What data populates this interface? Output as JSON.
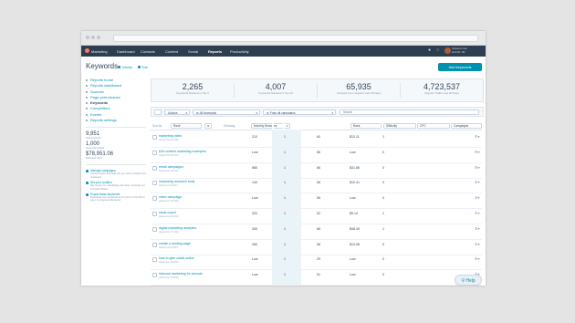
{
  "browser": {},
  "nav": {
    "items": [
      "Marketing",
      "Dashboard",
      "Contacts",
      "Content",
      "Social",
      "Reports",
      "Productivity"
    ],
    "active": "Reports",
    "account_name": "hubspot.com",
    "account_id": "Hub ID: 00"
  },
  "page": {
    "title": "Keywords",
    "links": [
      "Tutorial",
      "Tour"
    ],
    "add_button": "Add keywords"
  },
  "sidebar": {
    "items": [
      "Reports home",
      "Reports dashboard",
      "Sources",
      "Page performance",
      "Keywords",
      "Competitors",
      "Events",
      "Reports settings"
    ],
    "active": "Keywords",
    "stats": [
      {
        "value": "9,951",
        "label": "Total keywords"
      },
      {
        "value": "1,000",
        "label": "Keywords tracked"
      },
      {
        "value": "$78,951.06",
        "label": "Estimated value"
      }
    ],
    "help": [
      {
        "title": "Manage campaigns",
        "desc": "Choose topics that help you get more contacts and customers"
      },
      {
        "title": "Set your location",
        "desc": "Set country for calculating rank data. Currently set to United States."
      },
      {
        "title": "Export these keywords",
        "desc": "Download your keywords as an XLS or CSV file to open in programs like Excel."
      }
    ]
  },
  "summary": [
    {
      "value": "2,265",
      "label": "Keywords Ranked in Top 3"
    },
    {
      "value": "4,007",
      "label": "Keywords Ranked in Top 10"
    },
    {
      "value": "65,935",
      "label": "Contacts from Organic Last 30 Days"
    },
    {
      "value": "4,723,537",
      "label": "Organic Traffic Last 30 Days"
    }
  ],
  "toolbar": {
    "actions": "Actions",
    "filter": "All Keywords",
    "campaign": "From all campaigns",
    "search_placeholder": "Search"
  },
  "table": {
    "sort_label": "Sort by",
    "sort_value": "Rank",
    "show_label": "Showing",
    "show_value": "Monthly Searches",
    "columns": [
      "Rank",
      "Difficulty",
      "CPC",
      "Campaigns"
    ],
    "rows": [
      {
        "keyword": "marketing video",
        "added": "Added Oct 29 2014",
        "searches": "210",
        "rank": "1",
        "difficulty": "60",
        "cpc": "$13.11",
        "campaigns": "1"
      },
      {
        "keyword": "b2b content marketing examples",
        "added": "Added Oct 28 2014",
        "searches": "Low",
        "rank": "1",
        "difficulty": "56",
        "cpc": "Low",
        "campaigns": "0"
      },
      {
        "keyword": "email campaigns",
        "added": "Added Jan 28 2015",
        "searches": "880",
        "rank": "1",
        "difficulty": "66",
        "cpc": "$31.86",
        "campaigns": "0"
      },
      {
        "keyword": "marketing research tools",
        "added": "Added Jul 29 2014",
        "searches": "140",
        "rank": "1",
        "difficulty": "56",
        "cpc": "$10.41",
        "campaigns": "0"
      },
      {
        "keyword": "video campaign",
        "added": "Added Jan 28 2015",
        "searches": "Low",
        "rank": "1",
        "difficulty": "56",
        "cpc": "Low",
        "campaigns": "0"
      },
      {
        "keyword": "seals coach",
        "added": "Added Jan 09 2014",
        "searches": "320",
        "rank": "1",
        "difficulty": "52",
        "cpc": "$5.14",
        "campaigns": "1"
      },
      {
        "keyword": "digital marketing analytics",
        "added": "Added Oct 17 2014",
        "searches": "260",
        "rank": "1",
        "difficulty": "66",
        "cpc": "$48.49",
        "campaigns": "1"
      },
      {
        "keyword": "create a landing page",
        "added": "Added Jul 29 2014",
        "searches": "260",
        "rank": "1",
        "difficulty": "58",
        "cpc": "$13.08",
        "campaigns": "0"
      },
      {
        "keyword": "how to give credit online",
        "added": "Added Jan 28 2015",
        "searches": "Low",
        "rank": "1",
        "difficulty": "29",
        "cpc": "Low",
        "campaigns": "0"
      },
      {
        "keyword": "inbound marketing for schools",
        "added": "Added Jan 28 2015",
        "searches": "Low",
        "rank": "1",
        "difficulty": "51",
        "cpc": "Low",
        "campaigns": "0"
      }
    ]
  },
  "help_button": "Help",
  "colors": {
    "accent": "#0091ae",
    "nav": "#2d3e50",
    "highlight": "#eaf3f8"
  }
}
